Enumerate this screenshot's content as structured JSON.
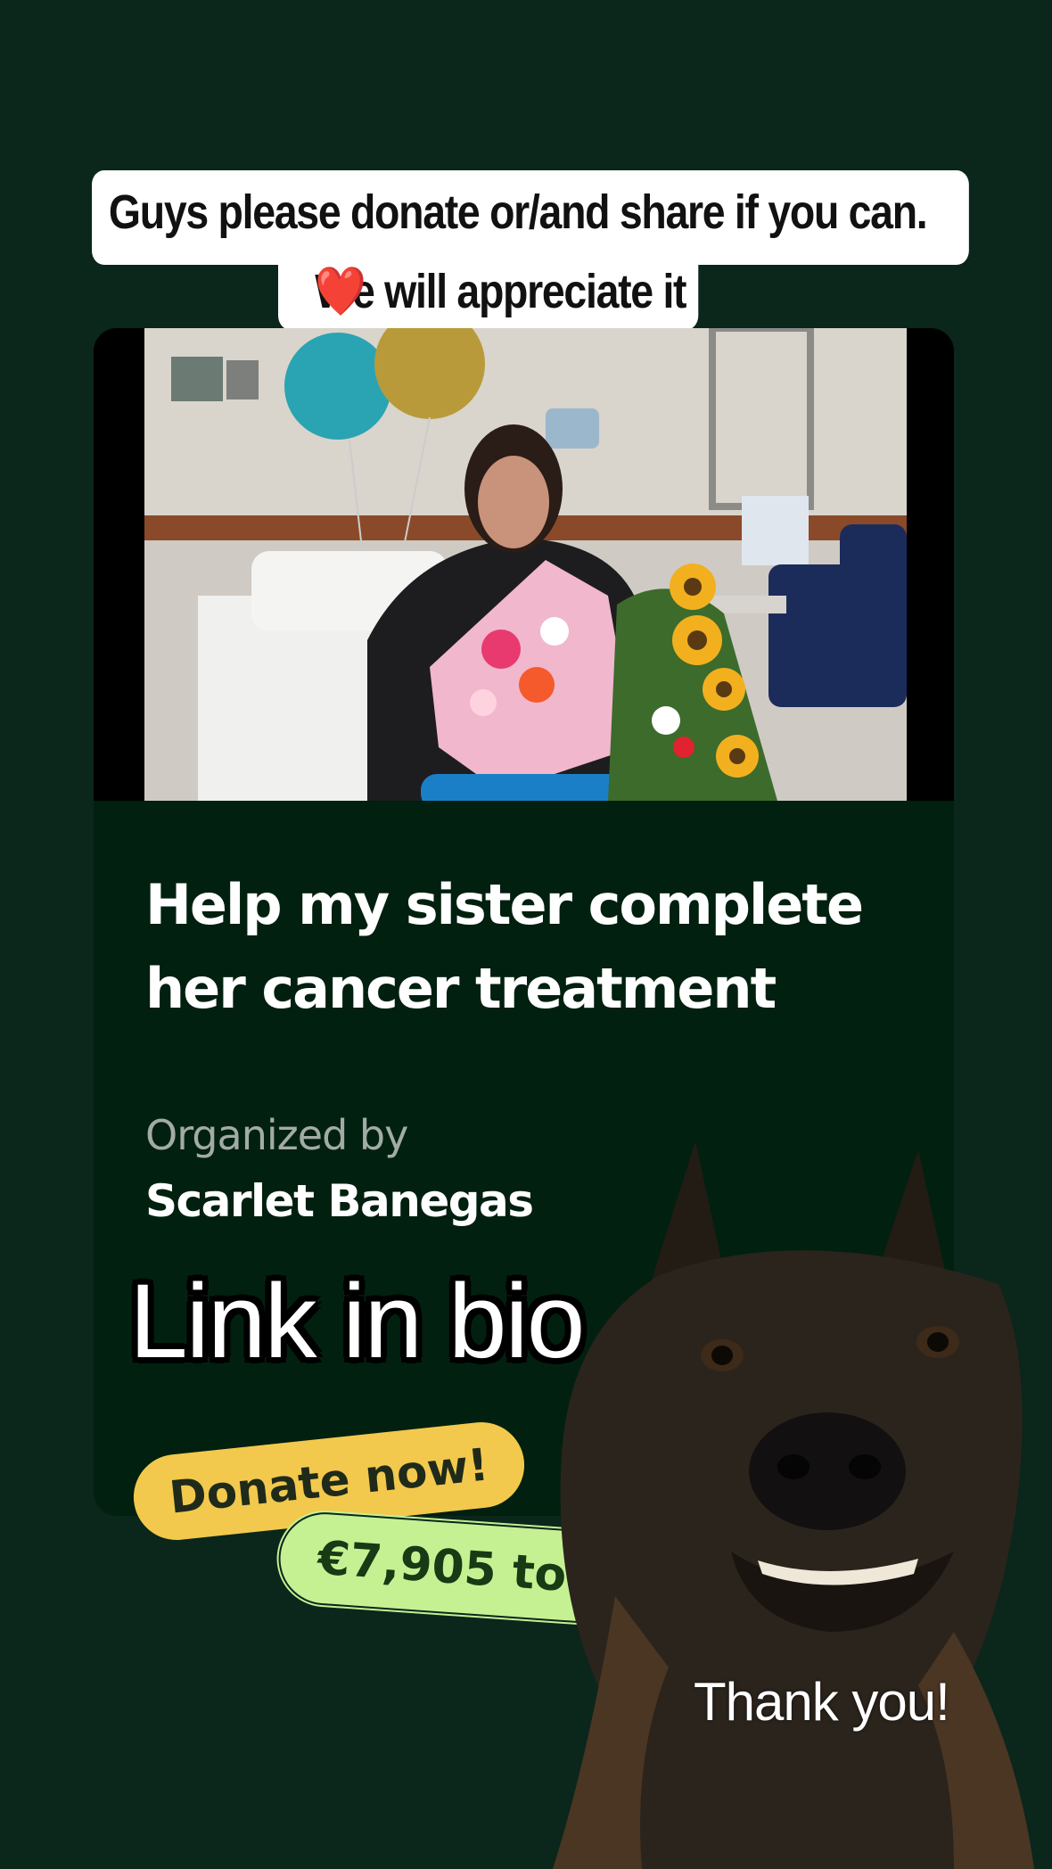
{
  "caption": {
    "line1": "Guys please donate or/and share if you can.",
    "line2": "We will appreciate it",
    "emoji": "❤️"
  },
  "card": {
    "title": "Help my sister complete her cancer treatment",
    "organizer_label": "Organized by",
    "organizer_name": "Scarlet Banegas"
  },
  "overlay": {
    "link_text": "Link in bio",
    "donate_label": "Donate now!",
    "goal_label": "€7,905 to goa",
    "thanks": "Thank you!"
  },
  "colors": {
    "background": "#0b261b",
    "card": "#02200f",
    "donate_pill": "#f2c94c",
    "goal_pill": "#c6f193"
  }
}
